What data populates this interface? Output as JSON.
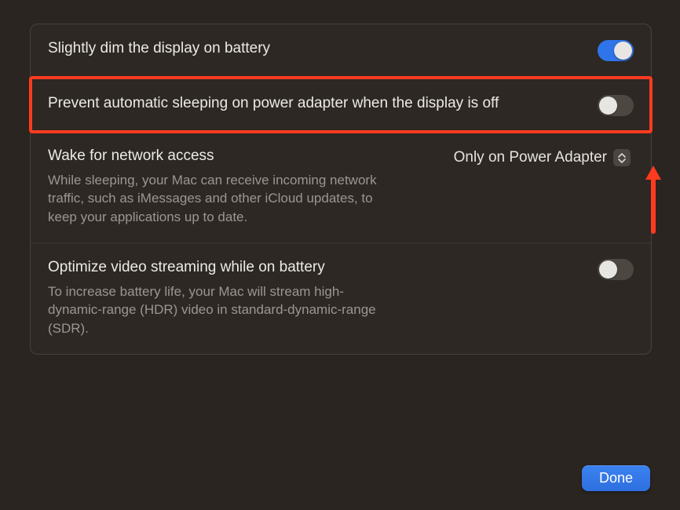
{
  "rows": {
    "dim": {
      "title": "Slightly dim the display on battery",
      "enabled": true
    },
    "prevent_sleep": {
      "title": "Prevent automatic sleeping on power adapter when the display is off",
      "enabled": false
    },
    "wake_net": {
      "title": "Wake for network access",
      "desc": "While sleeping, your Mac can receive incoming network traffic, such as iMessages and other iCloud updates, to keep your applications up to date.",
      "value": "Only on Power Adapter"
    },
    "optimize_video": {
      "title": "Optimize video streaming while on battery",
      "desc": "To increase battery life, your Mac will stream high-dynamic-range (HDR) video in standard-dynamic-range (SDR).",
      "enabled": false
    }
  },
  "buttons": {
    "done": "Done"
  },
  "colors": {
    "accent": "#2f74e8",
    "highlight": "#ff3b1f"
  }
}
